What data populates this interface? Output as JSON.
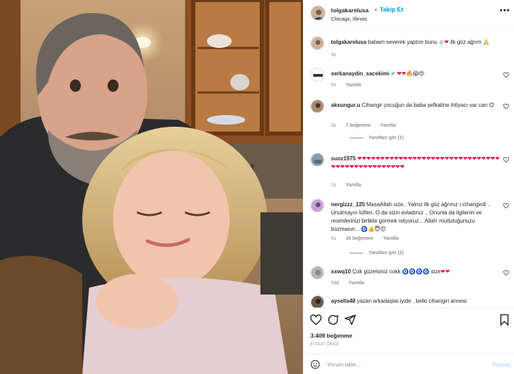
{
  "post": {
    "username": "tolgakarelusa",
    "dot": "•",
    "follow_label": "Takip Et",
    "location": "Chicago, Illinois",
    "more_label": "•••"
  },
  "caption": {
    "username": "tolgakarelusa",
    "text": "babam severek yaptım bunu ☺",
    "text2": " ilk göz ağrım ",
    "time": "9s"
  },
  "comments": [
    {
      "username": "serkanaydin_sacekimi",
      "text": "🔥😱😍",
      "time": "6s",
      "likes": "",
      "reply": "Yanıtla"
    },
    {
      "username": "aksungur.u",
      "text": "Cihangir çocuğun da baba şefkatine ihtiyacı var can",
      "emoji": "😊",
      "time": "3s",
      "likes": "7 beğenme",
      "reply": "Yanıtla",
      "thread": "Yanıtları gör (1)"
    },
    {
      "username": "suoz1975",
      "text": "",
      "time": "1s",
      "likes": "",
      "reply": "Yanıtla"
    },
    {
      "username": "nergizzz_125",
      "text": "MasaAllah size.. Yalnız ilk göz ağrınız ı cihangirdi .. Unutmayın lütfen..O da sizin evladınız .. Onunla da ilgilenin ve resimlerinizi birlikte görmek istiyoruz... Allah' mutluluğunuzu bozmasın...",
      "emoji": "🧿👍😇😊",
      "time": "5s",
      "likes": "16 beğenme",
      "reply": "Yanıtla",
      "thread": "Yanıtları gör (1)"
    },
    {
      "username": "xxwq10",
      "text": "Çok güzelsiniz cokk",
      "emoji": "🧿🧿🧿🧿",
      "text2": " size",
      "time": "58d",
      "likes": "",
      "reply": "Yanıtla"
    },
    {
      "username": "aysella48",
      "text": "yazan arkadaşlar.iyide , belki cihangiri annesi",
      "time": "",
      "likes": "",
      "reply": ""
    }
  ],
  "stats": {
    "likes": "3.409 beğenme",
    "time_ago": "8 SAAT ÖNCE"
  },
  "comment_box": {
    "placeholder": "Yorum ekle...",
    "post_label": "Paylaş"
  },
  "colors": {
    "accent": "#0095f6",
    "heart": "#e0245e",
    "muted": "#8e8e8e"
  },
  "icons": [
    "heart-icon",
    "comment-icon",
    "share-icon",
    "bookmark-icon",
    "emoji-icon",
    "verified-icon",
    "more-icon"
  ]
}
